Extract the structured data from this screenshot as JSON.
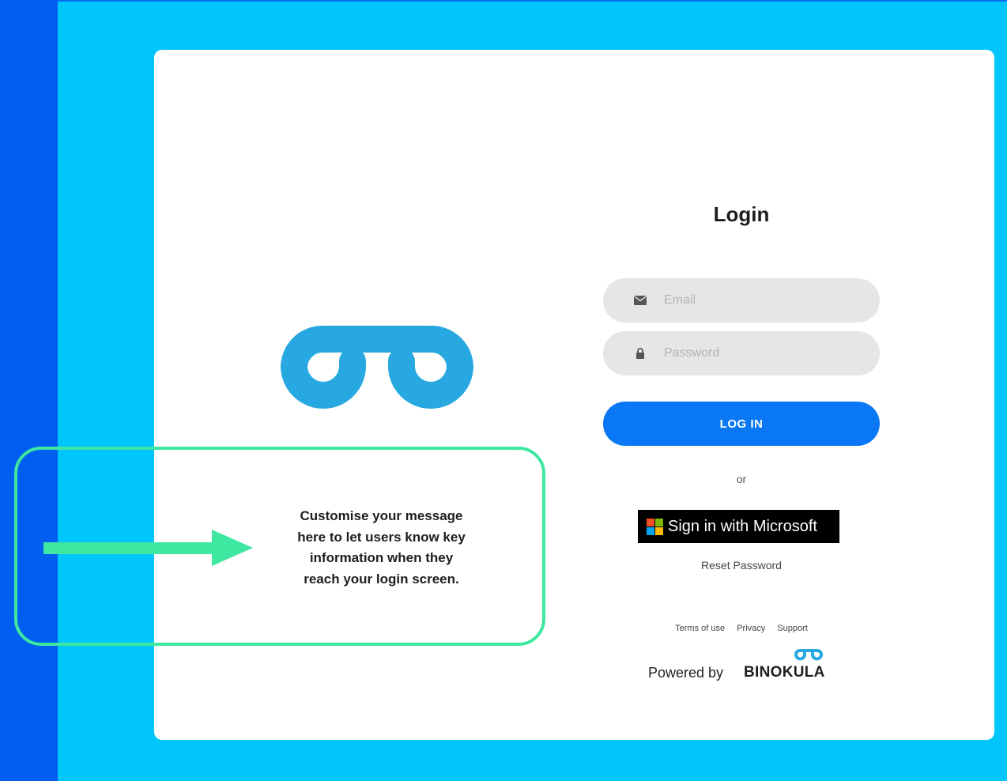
{
  "login": {
    "title": "Login",
    "email_placeholder": "Email",
    "password_placeholder": "Password",
    "login_button": "LOG IN",
    "or_text": "or",
    "microsoft_button": "Sign in with Microsoft",
    "reset_password": "Reset Password"
  },
  "message": {
    "lines": [
      "Customise your message",
      "here to let users know key",
      "information when they",
      "reach your login screen."
    ]
  },
  "footer": {
    "links": [
      "Terms of use",
      "Privacy",
      "Support"
    ],
    "powered_by": "Powered by",
    "brand": "BINOKULA"
  },
  "icons": {
    "email": "envelope-icon",
    "password": "lock-icon",
    "logo": "binokula-logo",
    "microsoft": "microsoft-logo"
  },
  "colors": {
    "background": "#00c6fc",
    "left_strip": "#005ff0",
    "card": "#ffffff",
    "logo": "#28a8e0",
    "callout": "#3ee8a0",
    "login_button": "#0a78f5",
    "field_bg": "#e6e6e6",
    "microsoft_red": "#f25022",
    "microsoft_green": "#7fba00",
    "microsoft_blue": "#00a4ef",
    "microsoft_yellow": "#ffb900"
  }
}
